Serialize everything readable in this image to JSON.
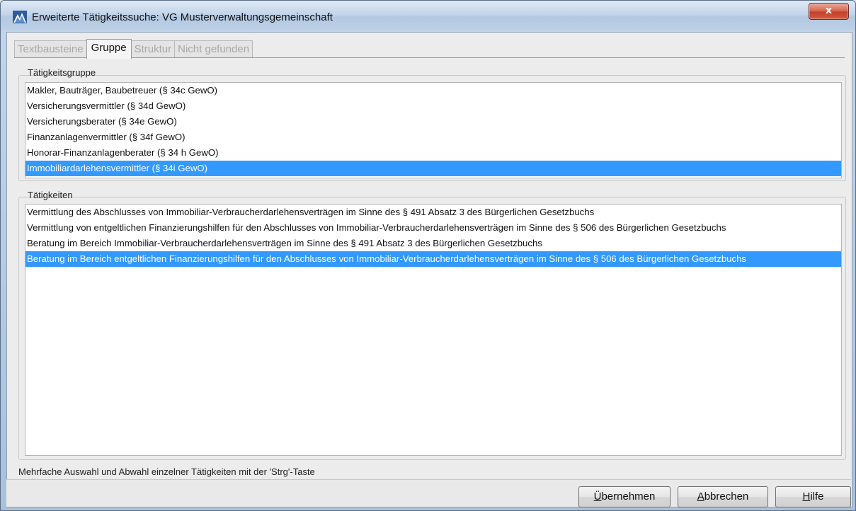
{
  "window": {
    "title": "Erweiterte Tätigkeitssuche: VG Musterverwaltungsgemeinschaft",
    "close_label": "x",
    "icon": "app-icon"
  },
  "tabs": [
    {
      "label": "Textbausteine",
      "enabled": false
    },
    {
      "label": "Gruppe",
      "enabled": true,
      "active": true
    },
    {
      "label": "Struktur",
      "enabled": false
    },
    {
      "label": "Nicht gefunden",
      "enabled": false
    }
  ],
  "gruppe": {
    "label": "Tätigkeitsgruppe",
    "items": [
      "Makler, Bauträger, Baubetreuer (§ 34c GewO)",
      "Versicherungsvermittler (§ 34d GewO)",
      "Versicherungsberater (§ 34e GewO)",
      "Finanzanlagenvermittler (§ 34f GewO)",
      "Honorar-Finanzanlagenberater (§ 34 h GewO)",
      "Immobiliardarlehensvermittler (§ 34i GewO)"
    ],
    "selected_index": 5
  },
  "taetigkeiten": {
    "label": "Tätigkeiten",
    "items": [
      "Vermittlung des Abschlusses von Immobiliar-Verbraucherdarlehensverträgen im Sinne des § 491 Absatz 3 des Bürgerlichen Gesetzbuchs",
      "Vermittlung von entgeltlichen Finanzierungshilfen für den Abschlusses von Immobiliar-Verbraucherdarlehensverträgen im Sinne des § 506 des Bürgerlichen Gesetzbuchs",
      "Beratung im Bereich Immobiliar-Verbraucherdarlehensverträgen im Sinne des § 491 Absatz 3 des Bürgerlichen Gesetzbuchs",
      "Beratung im Bereich entgeltlichen Finanzierungshilfen für den Abschlusses von Immobiliar-Verbraucherdarlehensverträgen im Sinne des § 506 des Bürgerlichen Gesetzbuchs"
    ],
    "selected_index": 3
  },
  "hint": "Mehrfache Auswahl und Abwahl einzelner Tätigkeiten mit der 'Strg'-Taste",
  "buttons": {
    "uebernehmen": {
      "mnemonic": "Ü",
      "rest": "bernehmen"
    },
    "abbrechen": {
      "mnemonic": "A",
      "rest": "bbrechen"
    },
    "hilfe": {
      "mnemonic": "H",
      "rest": "ilfe"
    }
  },
  "colors": {
    "selection": "#3399ff",
    "close_button": "#c2412b"
  }
}
